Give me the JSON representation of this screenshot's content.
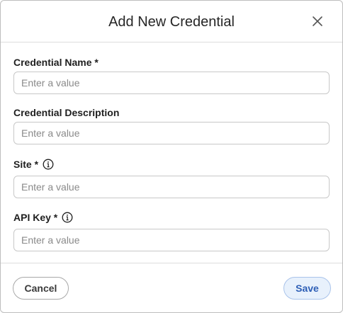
{
  "dialog": {
    "title": "Add New Credential",
    "close_icon": "close-icon"
  },
  "fields": {
    "name": {
      "label": "Credential Name *",
      "placeholder": "Enter a value",
      "value": ""
    },
    "description": {
      "label": "Credential Description",
      "placeholder": "Enter a value",
      "value": ""
    },
    "site": {
      "label": "Site *",
      "placeholder": "Enter a value",
      "value": "",
      "icon": "info-icon"
    },
    "api_key": {
      "label": "API Key *",
      "placeholder": "Enter a value",
      "value": "",
      "icon": "info-icon"
    }
  },
  "footer": {
    "cancel_label": "Cancel",
    "save_label": "Save"
  },
  "colors": {
    "save_bg": "#e8f1fc",
    "save_text": "#2e5fb6",
    "border": "#c8c8c8"
  }
}
